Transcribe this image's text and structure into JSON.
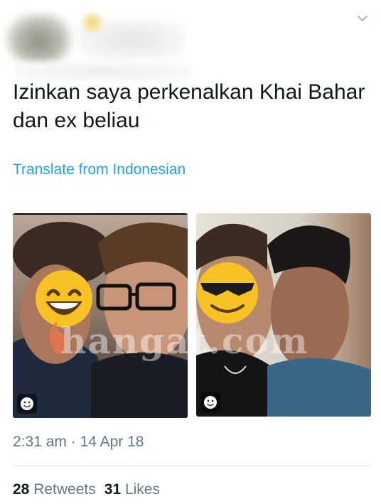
{
  "tweet": {
    "text": "Izinkan saya perkenalkan Khai Bahar dan ex beliau",
    "translate_label": "Translate from Indonesian",
    "time": "2:31 am",
    "separator": "·",
    "date": "14 Apr 18",
    "retweets_count": "28",
    "retweets_label": "Retweets",
    "likes_count": "31",
    "likes_label": "Likes"
  },
  "media": {
    "watermark": "hangat.com",
    "photos": [
      {
        "alt_icon": "smiley-icon",
        "sticker": "grinning-face-emoji"
      },
      {
        "alt_icon": "smiley-icon",
        "sticker": "sunglasses-face-emoji"
      }
    ]
  },
  "colors": {
    "link": "#1da1f2",
    "secondary_text": "#657786",
    "primary_text": "#14171a",
    "emoji_yellow": "#f8c224"
  }
}
